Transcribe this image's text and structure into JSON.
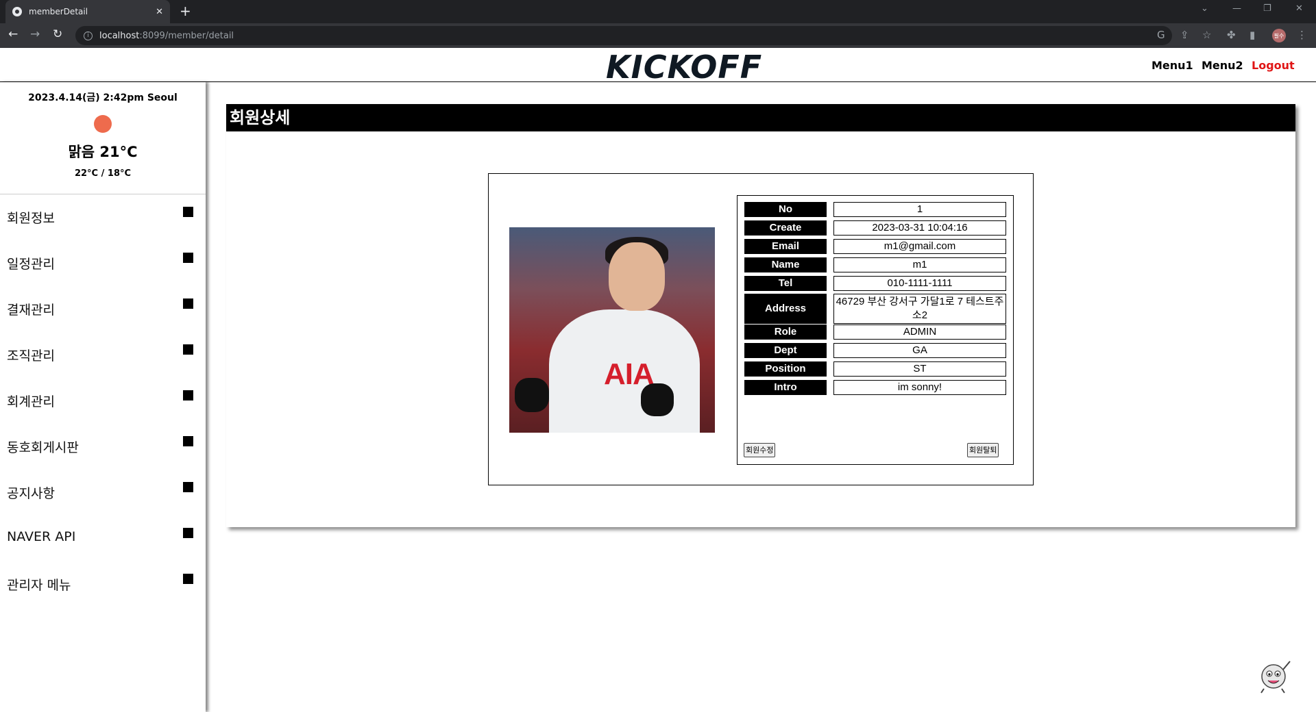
{
  "browser": {
    "tab_title": "memberDetail",
    "tab_close": "✕",
    "new_tab": "+",
    "url_host": "localhost",
    "url_path": ":8099/member/detail",
    "profile_initial": "필수"
  },
  "header": {
    "logo": "KICKOFF",
    "nav": [
      "Menu1",
      "Menu2",
      "Logout"
    ]
  },
  "weather": {
    "date": "2023.4.14(금) 2:42pm Seoul",
    "condition": "맑음 21°C",
    "range": "22°C / 18°C"
  },
  "sidebar": {
    "items": [
      "회원정보",
      "일정관리",
      "결재관리",
      "조직관리",
      "회계관리",
      "동호회게시판",
      "공지사항",
      "NAVER API",
      "관리자 메뉴"
    ]
  },
  "main": {
    "title": "회원상세",
    "photo_text": "AIA",
    "fields": [
      {
        "label": "No",
        "value": "1"
      },
      {
        "label": "Create",
        "value": "2023-03-31 10:04:16"
      },
      {
        "label": "Email",
        "value": "m1@gmail.com"
      },
      {
        "label": "Name",
        "value": "m1"
      },
      {
        "label": "Tel",
        "value": "010-1111-1111"
      },
      {
        "label": "Address",
        "value": "46729 부산 강서구 가달1로 7 테스트주소2"
      },
      {
        "label": "Role",
        "value": "ADMIN"
      },
      {
        "label": "Dept",
        "value": "GA"
      },
      {
        "label": "Position",
        "value": "ST"
      },
      {
        "label": "Intro",
        "value": "im sonny!"
      }
    ],
    "edit_button": "회원수정",
    "withdraw_button": "회원탈퇴"
  }
}
